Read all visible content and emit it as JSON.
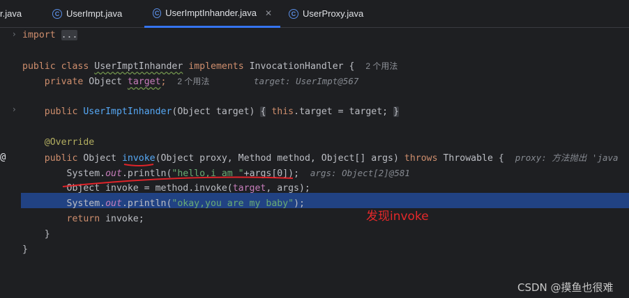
{
  "tabs": [
    {
      "label": "r.java",
      "icon": "java-class-icon"
    },
    {
      "label": "UserImpt.java",
      "icon": "java-class-icon"
    },
    {
      "label": "UserImptInhander.java",
      "icon": "java-class-icon",
      "active": true,
      "close": "✕"
    },
    {
      "label": "UserProxy.java",
      "icon": "java-class-icon"
    }
  ],
  "code": {
    "l1_kw": "import",
    "l1_fold": "...",
    "l3": {
      "public": "public",
      "class": "class",
      "name": "UserImptInhander",
      "implements": "implements",
      "iface": "InvocationHandler {",
      "usage": "2 个用法"
    },
    "l4": {
      "private": "private",
      "type": "Object",
      "field": "target",
      "semi": ";",
      "usage": "2 个用法",
      "hint": "target: UserImpt@567"
    },
    "l6": {
      "public": "public",
      "name": "UserImptInhander",
      "params": "(Object target)",
      "open": "{",
      "this": "this",
      "rest": ".target = target;",
      "close": "}"
    },
    "l8": "@Override",
    "l9": {
      "public": "public",
      "type": "Object",
      "name": "invoke",
      "params": "(Object proxy, Method method, Object[] args)",
      "throws": "throws",
      "exc": "Throwable {",
      "hint": "proxy: 方法抛出 'java"
    },
    "l10": {
      "pre": "System.",
      "out": "out",
      "mid": ".println(",
      "str": "\"hello,i am \"",
      "rest": "+args[0]);",
      "hint": "args: Object[2]@581"
    },
    "l11": {
      "pre": "Object invoke = method.invoke(",
      "field": "target",
      "rest": ", args);"
    },
    "l12": {
      "pre": "System.",
      "out": "out",
      "mid": ".println(",
      "str": "\"okay,you are my baby\"",
      "rest": ");"
    },
    "l13": {
      "return": "return",
      "rest": " invoke;"
    },
    "l14": "}",
    "l15": "}"
  },
  "annotation": "发现invoke",
  "watermark": "CSDN @摸鱼也很难"
}
